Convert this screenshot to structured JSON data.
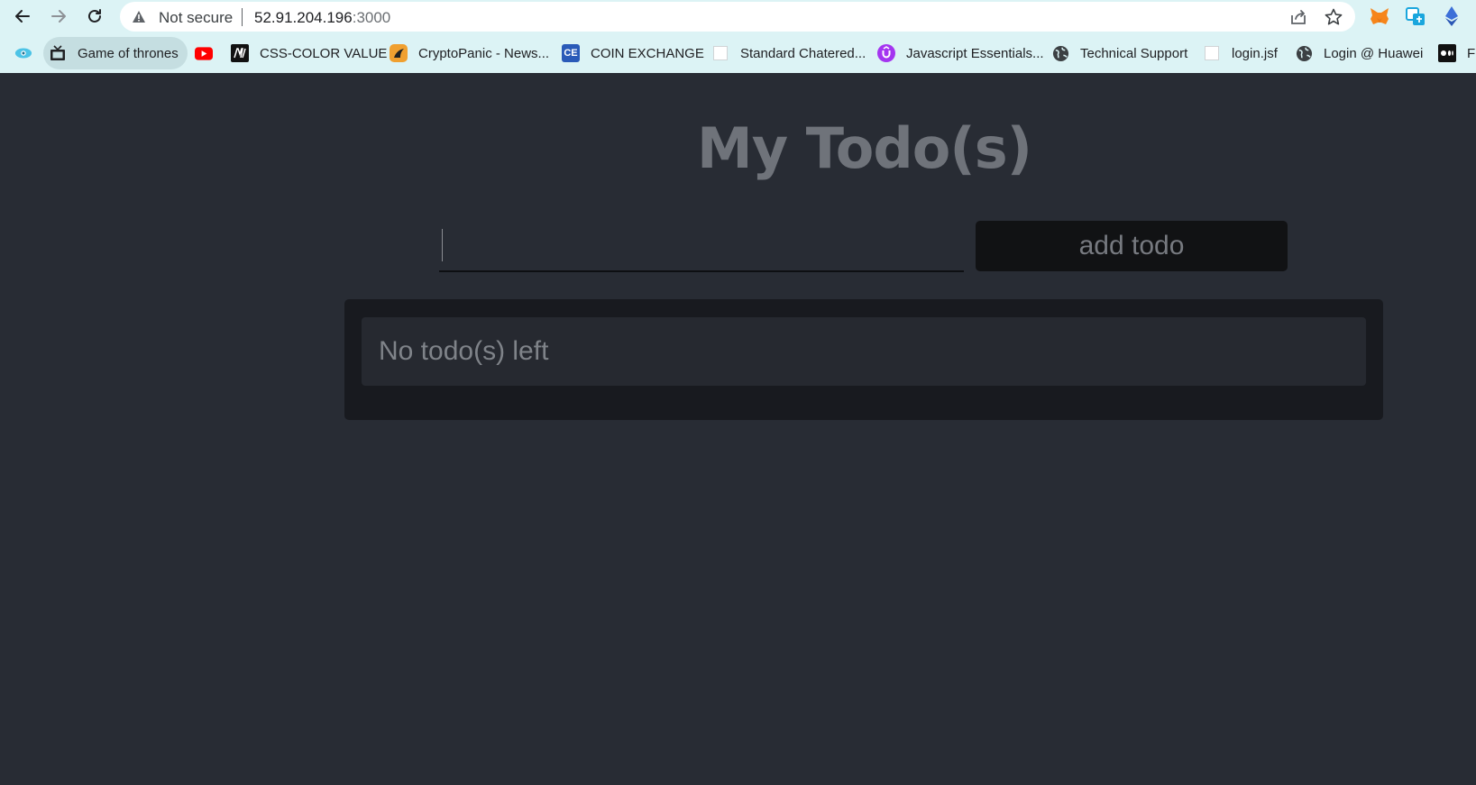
{
  "browser": {
    "security_label": "Not secure",
    "url_host": "52.91.204.196",
    "url_port": ":3000",
    "bookmarks": [
      {
        "label": "Game of thrones",
        "icon": "tv-icon"
      },
      {
        "label": "",
        "icon": "youtube-icon"
      },
      {
        "label": "CSS-COLOR VALUE",
        "icon": "medium-icon"
      },
      {
        "label": "CryptoPanic - News...",
        "icon": "cryptopanic-icon"
      },
      {
        "label": "COIN EXCHANGE",
        "icon": "ce-icon",
        "icon_text": "CE"
      },
      {
        "label": "Standard Chatered...",
        "icon": "page-icon"
      },
      {
        "label": "Javascript Essentials...",
        "icon": "udemy-icon"
      },
      {
        "label": "Technical Support",
        "icon": "globe-icon"
      },
      {
        "label": "login.jsf",
        "icon": "page-icon"
      },
      {
        "label": "Login @ Huawei",
        "icon": "globe-icon"
      },
      {
        "label": "Fr",
        "icon": "medium-dots-icon"
      }
    ]
  },
  "app": {
    "title": "My Todo(s)",
    "input_value": "",
    "add_button_label": "add todo",
    "empty_message": "No todo(s) left"
  },
  "colors": {
    "page_background": "#282c34",
    "panel_background": "#181a1f",
    "button_background": "#111214",
    "browser_chrome": "#dcf3f5"
  }
}
